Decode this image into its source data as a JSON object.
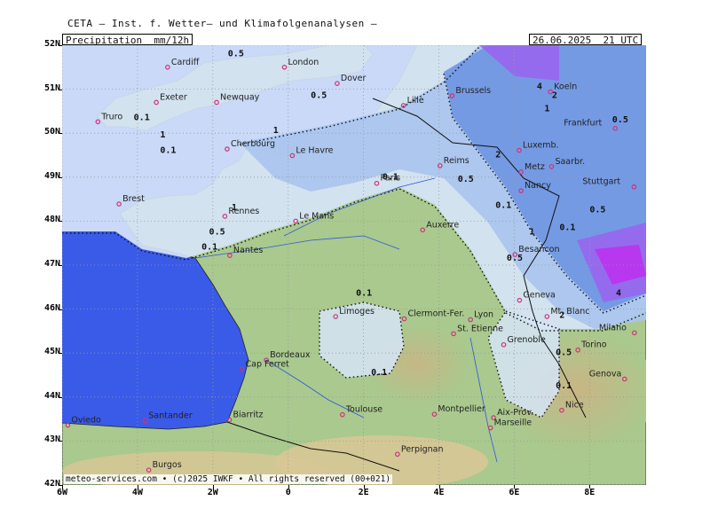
{
  "header": {
    "source": "CETA – Inst. f. Wetter– und Klimafolgenanalysen –",
    "variable": "Precipitation  mm/12h",
    "valid_time": "26.06.2025  21 UTC"
  },
  "axes": {
    "latitudes": [
      {
        "value": 52,
        "label": "52N"
      },
      {
        "value": 51,
        "label": "51N"
      },
      {
        "value": 50,
        "label": "50N"
      },
      {
        "value": 49,
        "label": "49N"
      },
      {
        "value": 48,
        "label": "48N"
      },
      {
        "value": 47,
        "label": "47N"
      },
      {
        "value": 46,
        "label": "46N"
      },
      {
        "value": 45,
        "label": "45N"
      },
      {
        "value": 44,
        "label": "44N"
      },
      {
        "value": 43,
        "label": "43N"
      },
      {
        "value": 42,
        "label": "42N"
      }
    ],
    "longitudes": [
      {
        "value": -6,
        "label": "6W"
      },
      {
        "value": -4,
        "label": "4W"
      },
      {
        "value": -2,
        "label": "2W"
      },
      {
        "value": 0,
        "label": "0"
      },
      {
        "value": 2,
        "label": "2E"
      },
      {
        "value": 4,
        "label": "4E"
      },
      {
        "value": 6,
        "label": "6E"
      },
      {
        "value": 8,
        "label": "8E"
      }
    ]
  },
  "colors": {
    "sea": "#3a5ae8",
    "land_low": "#a9c98e",
    "land_high": "#d9c796",
    "precip_light": "#d6e4f7",
    "precip_mod": "#a9c4ee",
    "precip_heavy": "#6f95e2",
    "precip_very_heavy": "#9966ee",
    "precip_extreme": "#bb33ee",
    "city_marker": "#cc3377"
  },
  "cities": [
    {
      "name": "Cardiff",
      "lon": -3.2,
      "lat": 51.5
    },
    {
      "name": "London",
      "lon": -0.1,
      "lat": 51.5
    },
    {
      "name": "Exeter",
      "lon": -3.5,
      "lat": 50.7
    },
    {
      "name": "Truro",
      "lon": -5.05,
      "lat": 50.26
    },
    {
      "name": "Newquay",
      "lon": -1.9,
      "lat": 50.7
    },
    {
      "name": "Dover",
      "lon": 1.3,
      "lat": 51.13
    },
    {
      "name": "Lille",
      "lon": 3.06,
      "lat": 50.63
    },
    {
      "name": "Brussels",
      "lon": 4.35,
      "lat": 50.85
    },
    {
      "name": "Koeln",
      "lon": 6.96,
      "lat": 50.94
    },
    {
      "name": "Frankfurt",
      "lon": 8.68,
      "lat": 50.11
    },
    {
      "name": "Le Havre",
      "lon": 0.11,
      "lat": 49.49
    },
    {
      "name": "Cherbourg",
      "lon": -1.62,
      "lat": 49.64
    },
    {
      "name": "Reims",
      "lon": 4.03,
      "lat": 49.26
    },
    {
      "name": "Luxemb.",
      "lon": 6.13,
      "lat": 49.61
    },
    {
      "name": "Saarbr.",
      "lon": 6.99,
      "lat": 49.24
    },
    {
      "name": "Paris",
      "lon": 2.35,
      "lat": 48.86
    },
    {
      "name": "Metz",
      "lon": 6.18,
      "lat": 49.12
    },
    {
      "name": "Nancy",
      "lon": 6.18,
      "lat": 48.69
    },
    {
      "name": "Stuttgart",
      "lon": 9.18,
      "lat": 48.78
    },
    {
      "name": "Brest",
      "lon": -4.49,
      "lat": 48.39
    },
    {
      "name": "Rennes",
      "lon": -1.68,
      "lat": 48.11
    },
    {
      "name": "Le Mans",
      "lon": 0.2,
      "lat": 48.0
    },
    {
      "name": "Auxerre",
      "lon": 3.57,
      "lat": 47.8
    },
    {
      "name": "Nantes",
      "lon": -1.55,
      "lat": 47.22
    },
    {
      "name": "Besancon",
      "lon": 6.02,
      "lat": 47.24
    },
    {
      "name": "Geneva",
      "lon": 6.14,
      "lat": 46.2
    },
    {
      "name": "Mt. Blanc",
      "lon": 6.87,
      "lat": 45.83
    },
    {
      "name": "Limoges",
      "lon": 1.26,
      "lat": 45.83
    },
    {
      "name": "Clermont-Fer.",
      "lon": 3.08,
      "lat": 45.78
    },
    {
      "name": "Lyon",
      "lon": 4.84,
      "lat": 45.76
    },
    {
      "name": "St. Etienne",
      "lon": 4.39,
      "lat": 45.44
    },
    {
      "name": "Grenoble",
      "lon": 5.72,
      "lat": 45.19
    },
    {
      "name": "Milano",
      "lon": 9.19,
      "lat": 45.46
    },
    {
      "name": "Torino",
      "lon": 7.69,
      "lat": 45.07
    },
    {
      "name": "Bordeaux",
      "lon": -0.58,
      "lat": 44.84
    },
    {
      "name": "Cap Ferret",
      "lon": -1.23,
      "lat": 44.63
    },
    {
      "name": "Genova",
      "lon": 8.93,
      "lat": 44.41
    },
    {
      "name": "Nice",
      "lon": 7.26,
      "lat": 43.7
    },
    {
      "name": "Montpellier",
      "lon": 3.88,
      "lat": 43.61
    },
    {
      "name": "Aix-Prov.",
      "lon": 5.45,
      "lat": 43.53
    },
    {
      "name": "Marseille",
      "lon": 5.37,
      "lat": 43.3
    },
    {
      "name": "Toulouse",
      "lon": 1.44,
      "lat": 43.6
    },
    {
      "name": "Biarritz",
      "lon": -1.56,
      "lat": 43.48
    },
    {
      "name": "Santander",
      "lon": -3.8,
      "lat": 43.46
    },
    {
      "name": "Oviedo",
      "lon": -5.85,
      "lat": 43.36
    },
    {
      "name": "Perpignan",
      "lon": 2.9,
      "lat": 42.7
    },
    {
      "name": "Burgos",
      "lon": -3.7,
      "lat": 42.34
    }
  ],
  "contour_labels": [
    {
      "text": "0.5",
      "lon": -1.6,
      "lat": 51.75
    },
    {
      "text": "0.5",
      "lon": 0.6,
      "lat": 50.8
    },
    {
      "text": "0.1",
      "lon": -4.1,
      "lat": 50.3
    },
    {
      "text": "1",
      "lon": -3.4,
      "lat": 49.9
    },
    {
      "text": "0.1",
      "lon": -3.4,
      "lat": 49.55
    },
    {
      "text": "1",
      "lon": -0.4,
      "lat": 50.0
    },
    {
      "text": "0.1",
      "lon": 2.5,
      "lat": 48.95
    },
    {
      "text": "0.5",
      "lon": 4.5,
      "lat": 48.9
    },
    {
      "text": "0.1",
      "lon": 5.5,
      "lat": 48.3
    },
    {
      "text": "1",
      "lon": -1.5,
      "lat": 48.25
    },
    {
      "text": "0.5",
      "lon": -2.1,
      "lat": 47.7
    },
    {
      "text": "0.1",
      "lon": -2.3,
      "lat": 47.35
    },
    {
      "text": "1",
      "lon": 6.4,
      "lat": 47.7
    },
    {
      "text": "0.5",
      "lon": 5.8,
      "lat": 47.1
    },
    {
      "text": "0.1",
      "lon": 1.8,
      "lat": 46.3
    },
    {
      "text": "0.1",
      "lon": 2.2,
      "lat": 44.5
    },
    {
      "text": "4",
      "lon": 6.6,
      "lat": 51.0
    },
    {
      "text": "2",
      "lon": 7.0,
      "lat": 50.8
    },
    {
      "text": "1",
      "lon": 6.8,
      "lat": 50.5
    },
    {
      "text": "0.5",
      "lon": 8.6,
      "lat": 50.25
    },
    {
      "text": "2",
      "lon": 5.5,
      "lat": 49.45
    },
    {
      "text": "0.5",
      "lon": 8.0,
      "lat": 48.2
    },
    {
      "text": "0.1",
      "lon": 7.2,
      "lat": 47.8
    },
    {
      "text": "4",
      "lon": 8.7,
      "lat": 46.3
    },
    {
      "text": "2",
      "lon": 7.2,
      "lat": 45.8
    },
    {
      "text": "0.5",
      "lon": 7.1,
      "lat": 44.95
    },
    {
      "text": "0.1",
      "lon": 7.1,
      "lat": 44.2
    }
  ],
  "credit": "meteo-services.com • (c)2025 IWKF • All rights reserved (00+021)"
}
